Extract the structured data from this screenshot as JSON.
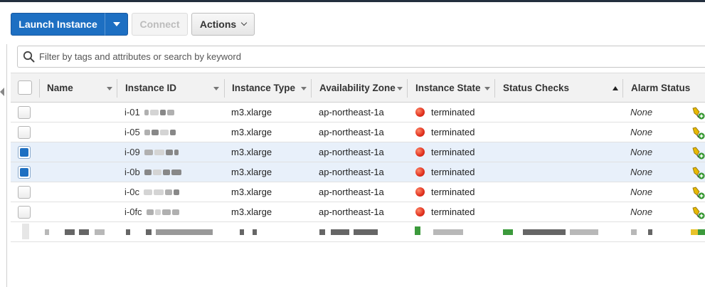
{
  "toolbar": {
    "launch_label": "Launch Instance",
    "connect_label": "Connect",
    "actions_label": "Actions"
  },
  "search": {
    "placeholder": "Filter by tags and attributes or search by keyword"
  },
  "columns": [
    {
      "label": "Name"
    },
    {
      "label": "Instance ID"
    },
    {
      "label": "Instance Type"
    },
    {
      "label": "Availability Zone"
    },
    {
      "label": "Instance State"
    },
    {
      "label": "Status Checks"
    },
    {
      "label": "Alarm Status"
    }
  ],
  "rows": [
    {
      "selected": false,
      "name": "",
      "instance_id": "i-01",
      "instance_type": "m3.xlarge",
      "availability_zone": "ap-northeast-1a",
      "instance_state": "terminated",
      "status_checks": "",
      "alarm_status": "None"
    },
    {
      "selected": false,
      "name": "",
      "instance_id": "i-05",
      "instance_type": "m3.xlarge",
      "availability_zone": "ap-northeast-1a",
      "instance_state": "terminated",
      "status_checks": "",
      "alarm_status": "None"
    },
    {
      "selected": true,
      "name": "",
      "instance_id": "i-09",
      "instance_type": "m3.xlarge",
      "availability_zone": "ap-northeast-1a",
      "instance_state": "terminated",
      "status_checks": "",
      "alarm_status": "None"
    },
    {
      "selected": true,
      "name": "",
      "instance_id": "i-0b",
      "instance_type": "m3.xlarge",
      "availability_zone": "ap-northeast-1a",
      "instance_state": "terminated",
      "status_checks": "",
      "alarm_status": "None"
    },
    {
      "selected": false,
      "name": "",
      "instance_id": "i-0c",
      "instance_type": "m3.xlarge",
      "availability_zone": "ap-northeast-1a",
      "instance_state": "terminated",
      "status_checks": "",
      "alarm_status": "None"
    },
    {
      "selected": false,
      "name": "",
      "instance_id": "i-0fc",
      "instance_type": "m3.xlarge",
      "availability_zone": "ap-northeast-1a",
      "instance_state": "terminated",
      "status_checks": "",
      "alarm_status": "None"
    }
  ],
  "colors": {
    "primary": "#1d6fc2",
    "terminated": "#e0301e",
    "selected_row": "#e8f0fa",
    "topbar": "#232f3e"
  },
  "icons": {
    "search": "search-icon",
    "alarm": "alarm-add-icon",
    "state": "state-dot-icon"
  }
}
